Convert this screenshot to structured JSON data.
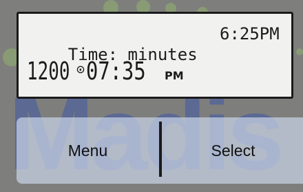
{
  "display": {
    "line1_label": "Time: minutes",
    "line1_time": "6:25PM",
    "line2_prefix": "1200",
    "line2_clock_symbol": "⊙",
    "line2_time": "07:35",
    "line2_ampm": "PM"
  },
  "softkeys": {
    "left_label": "Menu",
    "right_label": "Select"
  },
  "watermark": {
    "brand_text": "Madis"
  }
}
